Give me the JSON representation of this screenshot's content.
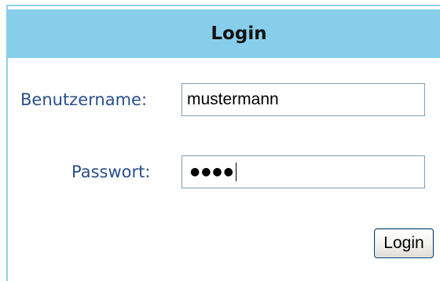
{
  "form": {
    "title": "Login",
    "username_label": "Benutzername:",
    "username_value": "mustermann",
    "password_label": "Passwort:",
    "password_masked": "●●●●",
    "submit_label": "Login"
  },
  "colors": {
    "header_background": "#87ceeb",
    "label_text": "#2a4f8a",
    "panel_border": "#8fd0e8"
  }
}
